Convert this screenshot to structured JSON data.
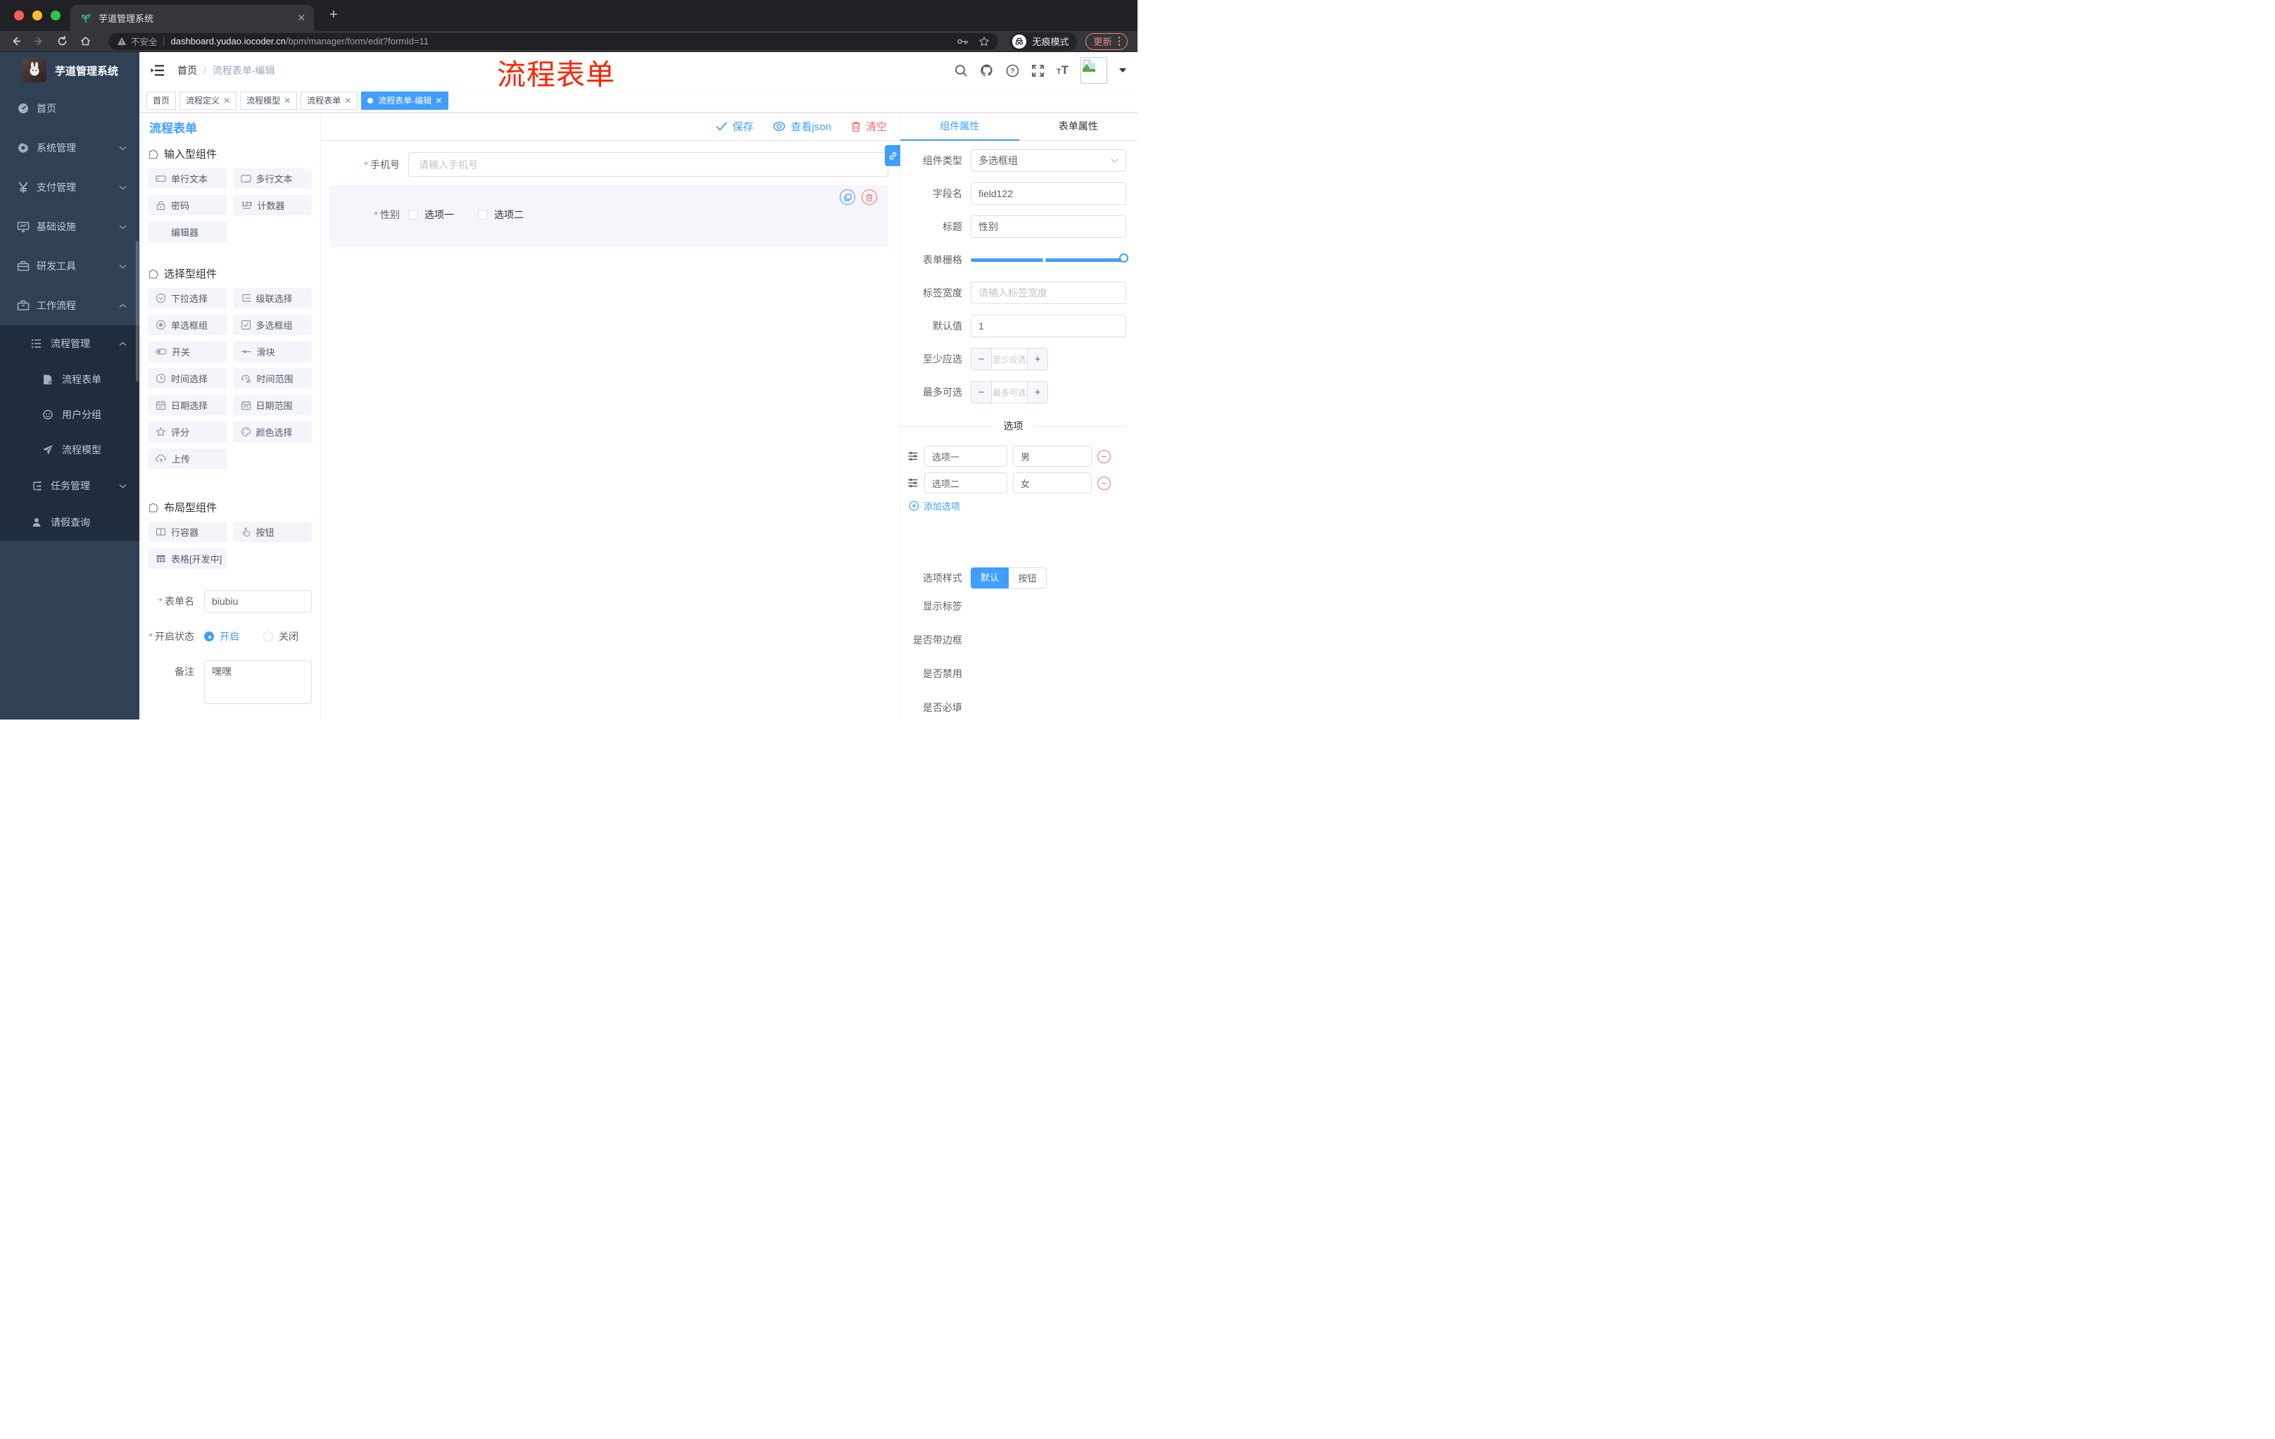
{
  "browser": {
    "tab_title": "芋道管理系统",
    "security_label": "不安全",
    "url_host": "dashboard.yudao.iocoder.cn",
    "url_path": "/bpm/manager/form/edit?formId=11",
    "incognito_label": "无痕模式",
    "update_label": "更新"
  },
  "annotation": {
    "overlay_text": "流程表单"
  },
  "sidebar": {
    "app_title": "芋道管理系统",
    "menu": [
      {
        "label": "首页"
      },
      {
        "label": "系统管理"
      },
      {
        "label": "支付管理"
      },
      {
        "label": "基础设施"
      },
      {
        "label": "研发工具"
      },
      {
        "label": "工作流程"
      }
    ],
    "submenu": [
      {
        "label": "流程管理"
      },
      {
        "label": "流程表单"
      },
      {
        "label": "用户分组"
      },
      {
        "label": "流程模型"
      },
      {
        "label": "任务管理"
      },
      {
        "label": "请假查询"
      }
    ]
  },
  "header": {
    "breadcrumb_home": "首页",
    "breadcrumb_current": "流程表单-编辑"
  },
  "tags": {
    "items": [
      {
        "label": "首页"
      },
      {
        "label": "流程定义"
      },
      {
        "label": "流程模型"
      },
      {
        "label": "流程表单"
      },
      {
        "label": "流程表单-编辑"
      }
    ]
  },
  "builder": {
    "title": "流程表单",
    "toolbar": {
      "save": "保存",
      "view_json": "查看json",
      "clear": "清空"
    },
    "components": {
      "sections": [
        {
          "title": "输入型组件",
          "items": [
            "单行文本",
            "多行文本",
            "密码",
            "计数器",
            "编辑器"
          ]
        },
        {
          "title": "选择型组件",
          "items": [
            "下拉选择",
            "级联选择",
            "单选框组",
            "多选框组",
            "开关",
            "滑块",
            "时间选择",
            "时间范围",
            "日期选择",
            "日期范围",
            "评分",
            "颜色选择",
            "上传"
          ]
        },
        {
          "title": "布局型组件",
          "items": [
            "行容器",
            "按钮",
            "表格[开发中]"
          ]
        }
      ]
    },
    "meta_form": {
      "name_label": "表单名",
      "name_value": "biubiu",
      "status_label": "开启状态",
      "status_on": "开启",
      "status_off": "关闭",
      "remark_label": "备注",
      "remark_value": "嘿嘿"
    },
    "canvas": {
      "phone_label": "手机号",
      "phone_placeholder": "请输入手机号",
      "gender_label": "性别",
      "gender_options": [
        "选项一",
        "选项二"
      ]
    },
    "props": {
      "tabs": [
        "组件属性",
        "表单属性"
      ],
      "component_type_label": "组件类型",
      "component_type_value": "多选框组",
      "field_name_label": "字段名",
      "field_name_value": "field122",
      "title_label": "标题",
      "title_value": "性别",
      "grid_label": "表单栅格",
      "label_width_label": "标签宽度",
      "label_width_placeholder": "请输入标签宽度",
      "default_label": "默认值",
      "default_value": "1",
      "min_label": "至少应选",
      "min_placeholder": "至少应选",
      "max_label": "最多可选",
      "max_placeholder": "最多可选",
      "options_title": "选项",
      "options": [
        {
          "label": "选项一",
          "value": "男"
        },
        {
          "label": "选项二",
          "value": "女"
        }
      ],
      "add_option": "添加选项",
      "style_label": "选项样式",
      "style_default": "默认",
      "style_button": "按钮",
      "switch_rows": [
        {
          "label": "显示标签",
          "on": true
        },
        {
          "label": "是否带边框",
          "on": false
        },
        {
          "label": "是否禁用",
          "on": false
        },
        {
          "label": "是否必填",
          "on": true
        }
      ]
    }
  },
  "colors": {
    "primary": "#409eff",
    "danger": "#f56c6c",
    "sidebar_bg": "#304156",
    "submenu_bg": "#1f2d3d"
  }
}
